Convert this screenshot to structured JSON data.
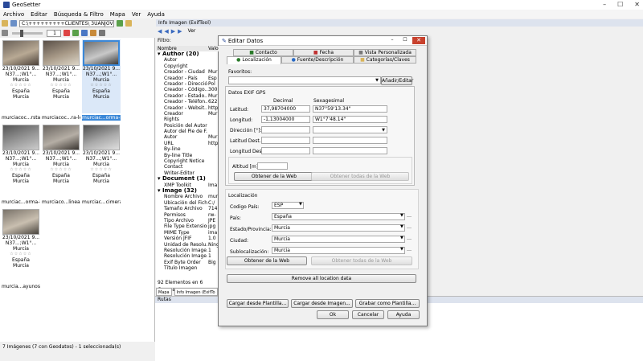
{
  "app": {
    "title": "GeoSetter",
    "win_buttons": [
      "–",
      "☐",
      "✕"
    ]
  },
  "menu": [
    "Archivo",
    "Editar",
    "Búsqueda & Filtro",
    "Mapa",
    "Ver",
    "Ayuda"
  ],
  "toolbar": {
    "path": "C:\\+++++++++CLIENTES\\ 3UANJOV",
    "page": "1"
  },
  "filter_label": "Filtro:",
  "thumbnails": [
    {
      "date": "23/10/2021 9...",
      "coords": "N37...;W1°...",
      "region": "Murcia",
      "country": "España",
      "city": "Murcia",
      "caption": "murciacoc...rstal",
      "selected": false
    },
    {
      "date": "23/10/2021 9...",
      "coords": "N37...;W1°...",
      "region": "Murcia",
      "country": "España",
      "city": "Murcia",
      "caption": "murciacoc...ra-led",
      "selected": false
    },
    {
      "date": "23/10/2021 9...",
      "coords": "N37...;W1°...",
      "region": "Murcia",
      "country": "España",
      "city": "Murcia",
      "caption": "murciac...orma-l",
      "selected": true
    },
    {
      "date": "23/10/2021 9...",
      "coords": "N37...;W1°...",
      "region": "Murcia",
      "country": "España",
      "city": "Murcia",
      "caption": "murciac...orma-l",
      "selected": false
    },
    {
      "date": "23/10/2021 9...",
      "coords": "N37...;W1°...",
      "region": "Murcia",
      "country": "España",
      "city": "Murcia",
      "caption": "murciaco...lineal",
      "selected": false
    },
    {
      "date": "23/10/2021 9...",
      "coords": "N37...;W1°...",
      "region": "Murcia",
      "country": "España",
      "city": "Murcia",
      "caption": "murciac...cimera",
      "selected": false
    },
    {
      "date": "23/10/2021 9...",
      "coords": "N37...;W1°...",
      "region": "Murcia",
      "country": "España",
      "city": "Murcia",
      "caption": "murcia...ayunos",
      "selected": false
    }
  ],
  "status_left": "7 Imágenes (7 con Geodatos) - 1 seleccionada(s)",
  "info_panel": {
    "title": "Info Imagen (ExifTool)",
    "ver": "Ver",
    "col_name": "Nombre",
    "col_value": "Valo",
    "rows": [
      {
        "type": "grp",
        "text": "Author (20)"
      },
      {
        "type": "itm",
        "text": "Autor",
        "val": ""
      },
      {
        "type": "itm",
        "text": "Copyright",
        "val": ""
      },
      {
        "type": "itm",
        "text": "Creador - Ciudad",
        "val": "Mur"
      },
      {
        "type": "itm",
        "text": "Creador - País",
        "val": "Esp"
      },
      {
        "type": "itm",
        "text": "Creador - Dirección",
        "val": "Pol"
      },
      {
        "type": "itm",
        "text": "Creador - Código...",
        "val": "300"
      },
      {
        "type": "itm",
        "text": "Creador - Estado...",
        "val": "Mur"
      },
      {
        "type": "itm",
        "text": "Creador - Teléfon...",
        "val": "622"
      },
      {
        "type": "itm",
        "text": "Creador - Websit...",
        "val": "http"
      },
      {
        "type": "itm",
        "text": "Creador",
        "val": "Mur"
      },
      {
        "type": "itm",
        "text": "Rights",
        "val": ""
      },
      {
        "type": "itm",
        "text": "Posición del Autor",
        "val": ""
      },
      {
        "type": "itm",
        "text": "Autor del Pie de F...",
        "val": ""
      },
      {
        "type": "itm",
        "text": "Autor",
        "val": "Mur"
      },
      {
        "type": "itm",
        "text": "URL",
        "val": "http"
      },
      {
        "type": "itm",
        "text": "By-line",
        "val": ""
      },
      {
        "type": "itm",
        "text": "By-line Title",
        "val": ""
      },
      {
        "type": "itm",
        "text": "Copyright Notice",
        "val": ""
      },
      {
        "type": "itm",
        "text": "Contact",
        "val": ""
      },
      {
        "type": "itm",
        "text": "Writer-Editor",
        "val": ""
      },
      {
        "type": "grp",
        "text": "Document (1)"
      },
      {
        "type": "itm",
        "text": "XMP Toolkit",
        "val": "Ima"
      },
      {
        "type": "grp",
        "text": "Image (32)"
      },
      {
        "type": "itm",
        "text": "Nombre Archivo",
        "val": "mur"
      },
      {
        "type": "itm",
        "text": "Ubicación del Fich...",
        "val": "C:/"
      },
      {
        "type": "itm",
        "text": "Tamaño Archivo",
        "val": "714"
      },
      {
        "type": "itm",
        "text": "Permisos",
        "val": "rw-"
      },
      {
        "type": "itm",
        "text": "Tipo Archivo",
        "val": "JPE"
      },
      {
        "type": "itm",
        "text": "File Type Extension",
        "val": "jpg"
      },
      {
        "type": "itm",
        "text": "MIME Type",
        "val": "ima"
      },
      {
        "type": "itm",
        "text": "Versión JFIF",
        "val": "1.0"
      },
      {
        "type": "itm",
        "text": "Unidad de Resolu...",
        "val": "Ning"
      },
      {
        "type": "itm",
        "text": "Resolución Image...",
        "val": "1"
      },
      {
        "type": "itm",
        "text": "Resolución Image...",
        "val": "1"
      },
      {
        "type": "itm",
        "text": "Exif Byte Order",
        "val": "Big"
      },
      {
        "type": "itm",
        "text": "Título Imagen",
        "val": ""
      }
    ],
    "elements_status": "92 Elementos en 6 Grupos",
    "bottom_tabs": [
      "Mapa",
      "Info Imagen (ExifTo"
    ],
    "rutas": "Rutas"
  },
  "dialog": {
    "title": "Editar Datos",
    "tabs_row1": [
      "Contacto",
      "Fecha",
      "Vista Personalizada"
    ],
    "tabs_row2": [
      "Localización",
      "Fuente/Descripción",
      "Categorías/Claves"
    ],
    "favoritos_label": "Favoritos:",
    "add_edit": "Añadir/Editar",
    "exif_gps": "Datos EXIF GPS",
    "decimal_hdr": "Decimal",
    "sexa_hdr": "Sexagesimal",
    "lat_label": "Latitud:",
    "lat_dec": "37,98704000",
    "lat_sexa": "N37°59'13.34\"",
    "lon_label": "Longitud:",
    "lon_dec": "-1,13004000",
    "lon_sexa": "W1°7'48.14\"",
    "dir_label": "Dirección [°]:",
    "lat_dest_label": "Latitud Dest.:",
    "lon_dest_label": "Longitud Dest.:",
    "alt_label": "Altitud [m]:",
    "get_web": "Obtener de la Web",
    "get_all_web": "Obtener todas de la Web",
    "location_hdr": "Localización",
    "country_code_label": "Codigo País:",
    "country_code": "ESP",
    "country_label": "País:",
    "country": "España",
    "state_label": "Estado/Provincia:",
    "state": "Murcia",
    "city_label": "Ciudad:",
    "city": "Murcia",
    "subloc_label": "Sublocalización:",
    "subloc": "Murcia",
    "get_web2": "Obtener de la Web",
    "get_all_web2": "Obtener todas de la Web",
    "remove_all": "Remove all location data",
    "load_template": "Cargar desde Plantilla...",
    "load_image": "Cargar desde Imagen...",
    "save_template": "Grabar como Plantilla...",
    "ok": "Ok",
    "cancel": "Cancelar",
    "help": "Ayuda"
  }
}
